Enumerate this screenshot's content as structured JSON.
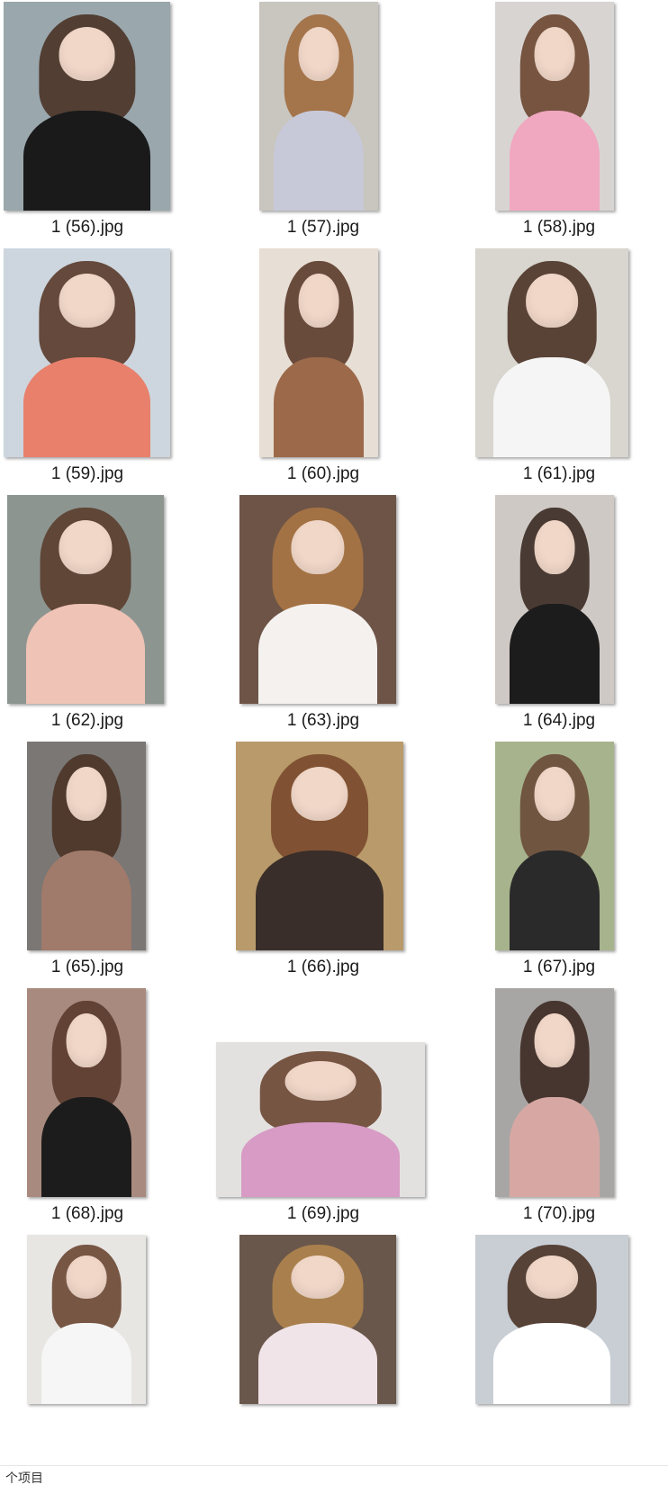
{
  "files": [
    {
      "name": "1 (56).jpg",
      "bg": "#9aa7ad",
      "hair": "#4a3326",
      "top": "#1a1a1a",
      "icon": "image-thumbnail-icon"
    },
    {
      "name": "1 (57).jpg",
      "bg": "#c9c5bf",
      "hair": "#a06a3e",
      "top": "#c7c9d8",
      "icon": "image-thumbnail-icon"
    },
    {
      "name": "1 (58).jpg",
      "bg": "#d8d4d2",
      "hair": "#6b4630",
      "top": "#f0a7c0",
      "icon": "image-thumbnail-icon"
    },
    {
      "name": "1 (59).jpg",
      "bg": "#cdd6de",
      "hair": "#5a3a2a",
      "top": "#e8806c",
      "icon": "image-thumbnail-icon"
    },
    {
      "name": "1 (60).jpg",
      "bg": "#e7ded5",
      "hair": "#5b3b2b",
      "top": "#9c6a4a",
      "icon": "image-thumbnail-icon"
    },
    {
      "name": "1 (61).jpg",
      "bg": "#d9d5cf",
      "hair": "#4a3326",
      "top": "#f5f5f5",
      "icon": "image-thumbnail-icon"
    },
    {
      "name": "1 (62).jpg",
      "bg": "#8d9591",
      "hair": "#5a3d2e",
      "top": "#efc3b5",
      "icon": "image-thumbnail-icon"
    },
    {
      "name": "1 (63).jpg",
      "bg": "#6d5446",
      "hair": "#a87544",
      "top": "#f4f1ef",
      "icon": "image-thumbnail-icon"
    },
    {
      "name": "1 (64).jpg",
      "bg": "#cfc9c5",
      "hair": "#3a2a22",
      "top": "#1c1c1c",
      "icon": "image-thumbnail-icon"
    },
    {
      "name": "1 (65).jpg",
      "bg": "#7a7775",
      "hair": "#4a3326",
      "top": "#a07a6a",
      "icon": "image-thumbnail-icon"
    },
    {
      "name": "1 (66).jpg",
      "bg": "#b99a6a",
      "hair": "#7a4a2e",
      "top": "#3a2e2a",
      "icon": "image-thumbnail-icon"
    },
    {
      "name": "1 (67).jpg",
      "bg": "#a7b38c",
      "hair": "#6a4a38",
      "top": "#2a2a2a",
      "icon": "image-thumbnail-icon"
    },
    {
      "name": "1 (68).jpg",
      "bg": "#a88a7e",
      "hair": "#5a3a2e",
      "top": "#1c1c1c",
      "icon": "image-thumbnail-icon"
    },
    {
      "name": "1 (69).jpg",
      "bg": "#e3e1df",
      "hair": "#6a4632",
      "top": "#d79bc5",
      "icon": "image-thumbnail-icon"
    },
    {
      "name": "1 (70).jpg",
      "bg": "#a8a6a5",
      "hair": "#3c2a22",
      "top": "#d7a8a3",
      "icon": "image-thumbnail-icon"
    },
    {
      "name": "",
      "bg": "#e8e6e3",
      "hair": "#6a4632",
      "top": "#f6f6f6",
      "icon": "image-thumbnail-icon"
    },
    {
      "name": "",
      "bg": "#6a574b",
      "hair": "#b0854e",
      "top": "#f1e4e8",
      "icon": "image-thumbnail-icon"
    },
    {
      "name": "",
      "bg": "#c8ced4",
      "hair": "#4a3326",
      "top": "#ffffff",
      "icon": "image-thumbnail-icon"
    }
  ],
  "status": {
    "count_text": "个项目"
  }
}
